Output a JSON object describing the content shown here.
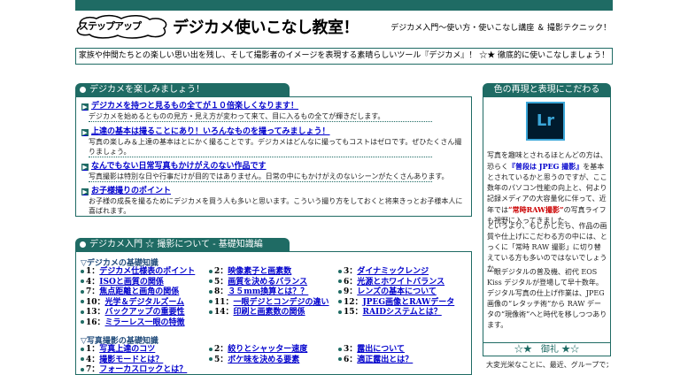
{
  "header": {
    "logo_text": "ステップアップ",
    "site_title": "デジカメ使いこなし教室！",
    "tagline": "デジカメ入門～使い方・使いこなし講座 ＆ 撮影テクニック！"
  },
  "banner": "家族や仲間たちとの楽しい思い出を残し、そして撮影者のイメージを表現する素晴らしいツール『デジカメ』！ ☆★ 徹底的に使いこなしましょう！",
  "section1": {
    "title": "デジカメを楽しみましょう！",
    "items": [
      {
        "title": "デジカメを持つと見るもの全てが１０倍楽しくなります！",
        "desc": "デジカメを始めるとものの見方・見え方が変わって来て、目に入るもの全てが輝きだします。"
      },
      {
        "title": "上達の基本は撮ることにあり！いろんなものを撮ってみましょう！",
        "desc": "写真の楽しみ＆上達の基本はとにかく撮ることです。デジカメはどんなに撮ってもコストはゼロです。ぜひたくさん撮りましょう。"
      },
      {
        "title": "なんでもない日常写真もかけがえのない作品です",
        "desc": "写真撮影は特別な日や行事だけが目的ではありません。日常の中にもかけがえのないシーンがたくさんあります。"
      },
      {
        "title": "お子様撮りのポイント",
        "desc": "お子様の成長を撮るためにデジカメを買う人も多いと思います。こういう撮り方をしておくと将来きっとお子様本人に喜ばれます。"
      }
    ]
  },
  "section2": {
    "title": "デジカメ入門 ☆ 撮影について - 基礎知識編",
    "groups": [
      {
        "title": "▽デジカメの基礎知識",
        "links": [
          {
            "num": "1：",
            "label": "デジカメ仕様表のポイント"
          },
          {
            "num": "2：",
            "label": "映像素子と画素数"
          },
          {
            "num": "3：",
            "label": "ダイナミックレンジ"
          },
          {
            "num": "4：",
            "label": "ISOと画質の関係"
          },
          {
            "num": "5：",
            "label": "画質を決めるバランス"
          },
          {
            "num": "6：",
            "label": "光源とホワイトバランス"
          },
          {
            "num": "7：",
            "label": "焦点距離と画角の関係"
          },
          {
            "num": "8：",
            "label": "３５mm換算とは？？"
          },
          {
            "num": "9：",
            "label": "レンズの基本について"
          },
          {
            "num": "10：",
            "label": "光学＆デジタルズーム"
          },
          {
            "num": "11：",
            "label": "一眼デジとコンデジの違い"
          },
          {
            "num": "12：",
            "label": "JPEG画像とRAWデータ"
          },
          {
            "num": "13：",
            "label": "バックアップの重要性"
          },
          {
            "num": "14：",
            "label": "印刷と画素数の関係"
          },
          {
            "num": "15：",
            "label": "RAIDシステムとは？"
          },
          {
            "num": "16：",
            "label": "ミラーレス一眼の特徴"
          }
        ]
      },
      {
        "title": "▽写真撮影の基礎知識",
        "links": [
          {
            "num": "1：",
            "label": "写真上達のコツ"
          },
          {
            "num": "2：",
            "label": "絞りとシャッター速度"
          },
          {
            "num": "3：",
            "label": "露出について"
          },
          {
            "num": "4：",
            "label": "撮影モードとは？"
          },
          {
            "num": "5：",
            "label": "ボケ味を決める要素"
          },
          {
            "num": "6：",
            "label": "適正露出とは？"
          },
          {
            "num": "7：",
            "label": "フォーカスロックとは？"
          }
        ]
      }
    ]
  },
  "sidebar": {
    "box1_title": "色の再現と表現にこだわる",
    "lr_icon_text": "Lr",
    "p1_a": "写真を趣味とされるほとんどの方は、恐らく",
    "p1_hl1": "『普段は JPEG 撮影』",
    "p1_b": "を基本とされているかと思うのですが、ここ数年のパソコン性能の向上と、何より記録メディアの大容量化に伴って、近年では",
    "p1_hl2": "“常時RAW撮影”",
    "p1_c": "の写真ライフも視野に入ってきました。",
    "p2": "というより、もしかしたら、作品の画質や仕上げにこだわる方の中には、とっくに「常時 RAW 撮影」に切り替えている方も多いのではないでしょうか。",
    "p3": "一眼デジタルの普及機、初代 EOS Kiss デジタルが登場して早十数年。デジタル写真の仕上げ作業は、JPEG 画像の“レタッチ術”から RAW データの“現像術”へと時代を移しつつあります。",
    "box2_title": "☆★　御礼 ★☆",
    "box2_text": "大変光栄なことに、最近、グループでカメ"
  }
}
